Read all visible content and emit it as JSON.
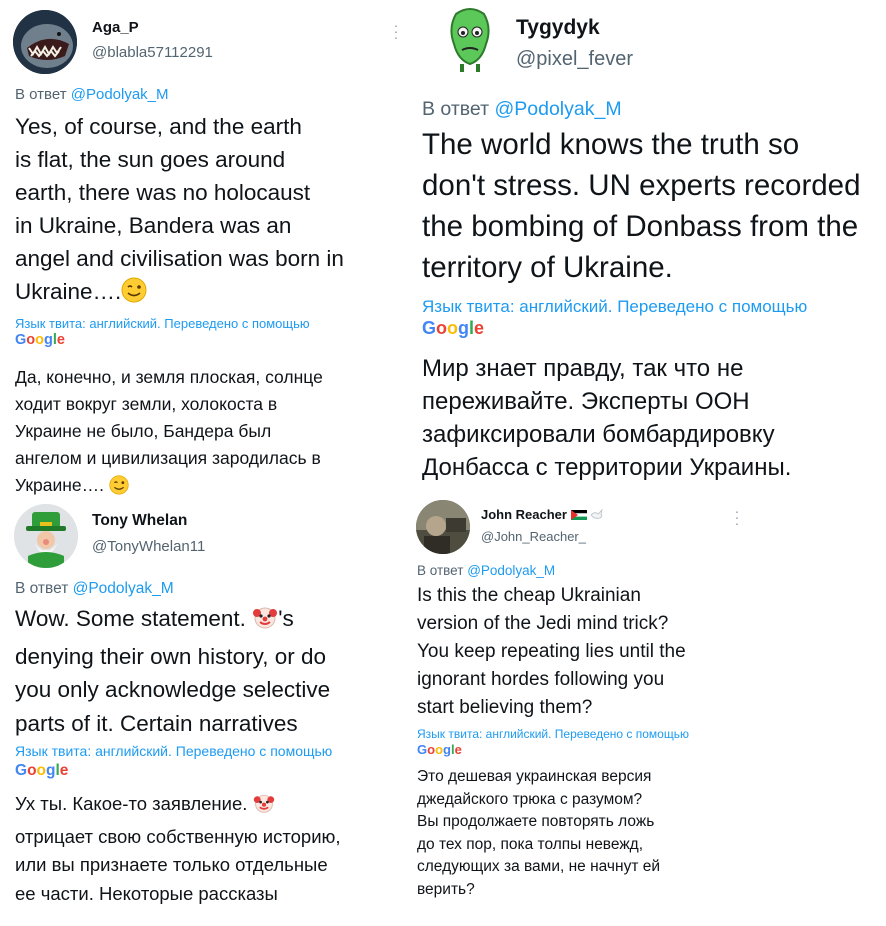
{
  "colors": {
    "mention": "#1d9bf0",
    "text": "#0f1419",
    "muted": "#536471"
  },
  "google_letters": [
    "G",
    "o",
    "o",
    "g",
    "l",
    "e"
  ],
  "tweets": [
    {
      "name": "Aga_P",
      "handle": "@blabla57112291",
      "reply_prefix": "В ответ",
      "reply_to": "@Podolyak_M",
      "text_en": "Yes, of course, and the earth\nis flat, the sun goes around\nearth, there was no holocaust\nin Ukraine, Bandera was an\nangel and civilisation was born in\nUkraine….",
      "translate_note": "Язык твита: английский. Переведено с помощью",
      "text_ru": "Да, конечно, и земля плоская, солнце\nходит вокруг земли, холокоста в\nУкраине не было, Бандера был\nангелом и цивилизация зародилась в\nУкраине….",
      "avatar_icon": "shark-avatar-icon",
      "emoji_icon": "winking-face-icon"
    },
    {
      "name": "Tygydyk",
      "handle": "@pixel_fever",
      "reply_prefix": "В ответ",
      "reply_to": "@Podolyak_M",
      "text_en": "The world knows the truth so\ndon't stress. UN experts recorded\nthe bombing of Donbass from the\nterritory of Ukraine.",
      "translate_note": "Язык твита: английский. Переведено с помощью",
      "text_ru": "Мир знает правду, так что не\nпереживайте. Эксперты ООН\nзафиксировали бомбардировку\nДонбасса с территории Украины.",
      "avatar_icon": "green-face-avatar-icon"
    },
    {
      "name": "Tony Whelan",
      "handle": "@TonyWhelan11",
      "reply_prefix": "В ответ",
      "reply_to": "@Podolyak_M",
      "text_en_a": "Wow. Some statement. ",
      "text_en_b": "'s\ndenying their own history,  or do\nyou only acknowledge selective\nparts of it. Certain narratives",
      "translate_note": "Язык твита: английский. Переведено с помощью",
      "text_ru_a": "Ух ты. Какое-то заявление. ",
      "text_ru_b": "\nотрицает свою собственную историю,\nили вы признаете только отдельные\nее части. Некоторые рассказы",
      "avatar_icon": "leprechaun-gnome-avatar-icon",
      "emoji_icon": "clown-face-icon"
    },
    {
      "name": "John Reacher",
      "handle": "@John_Reacher_",
      "reply_prefix": "В ответ",
      "reply_to": "@Podolyak_M",
      "text_en": "Is this the cheap Ukrainian\nversion of the Jedi mind trick?\nYou keep repeating lies until the\nignorant hordes following you\nstart believing them?",
      "translate_note": "Язык твита: английский. Переведено с помощью",
      "text_ru": "Это дешевая украинская версия\nджедайского трюка с разумом?\nВы продолжаете повторять ложь\nдо тех пор, пока толпы невежд,\nследующих за вами, не начнут ей\nверить?",
      "avatar_icon": "photo-avatar-icon",
      "flag_icon": "palestine-flag-icon",
      "dove_icon": "dove-icon"
    }
  ]
}
